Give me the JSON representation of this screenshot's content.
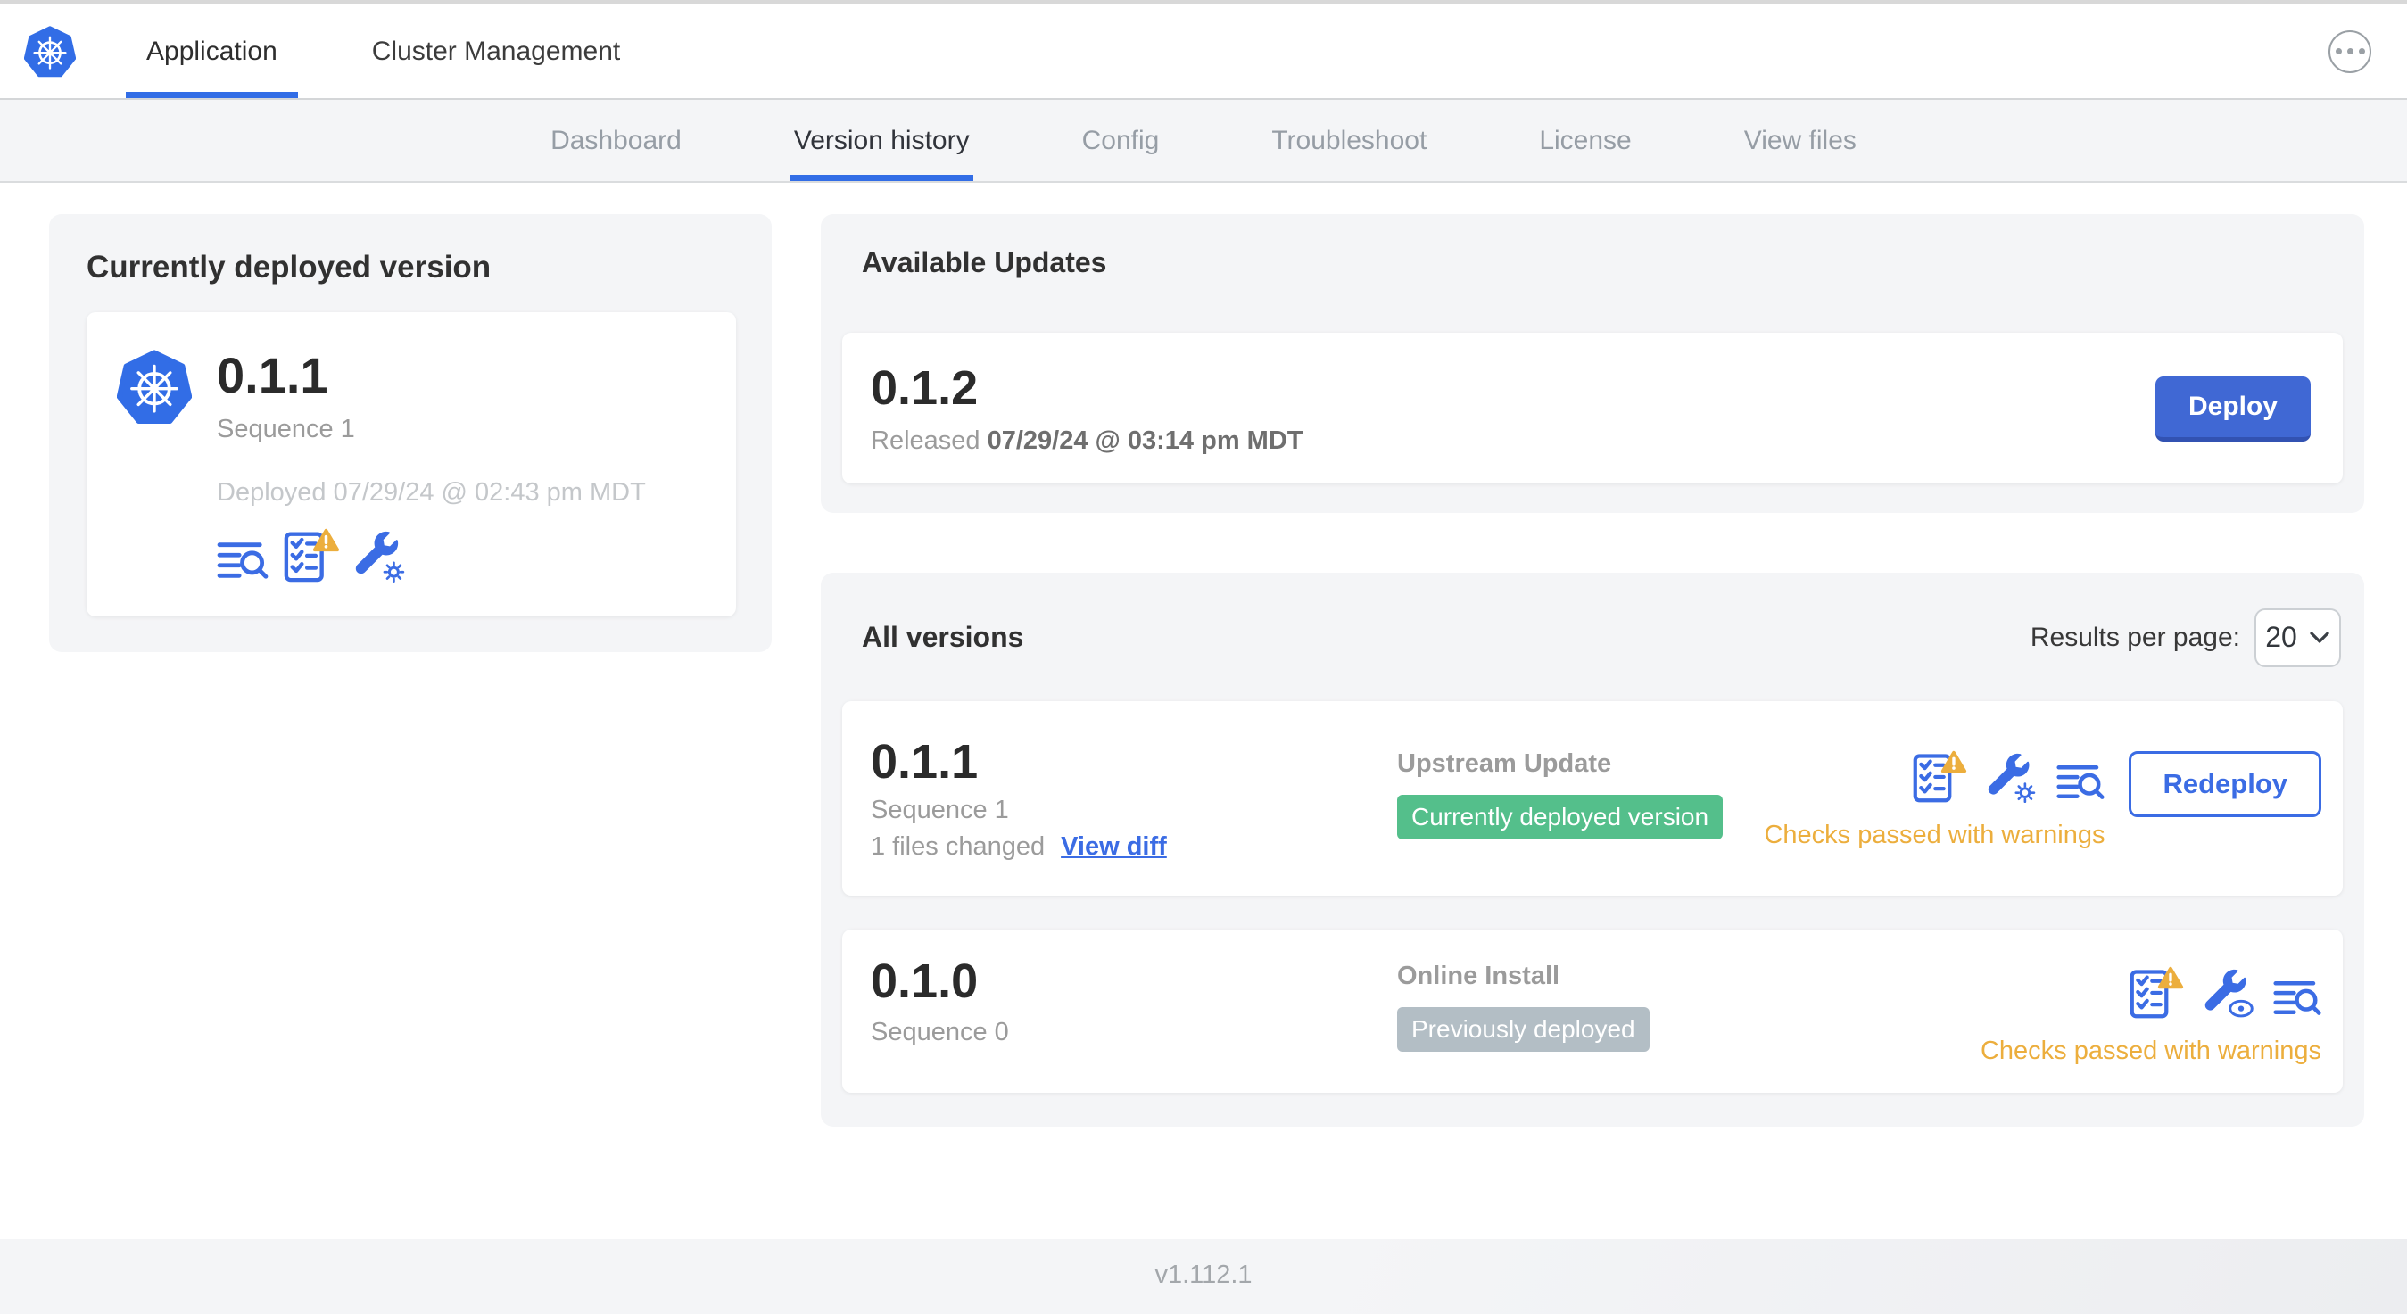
{
  "header": {
    "tabs": [
      {
        "label": "Application"
      },
      {
        "label": "Cluster Management"
      }
    ]
  },
  "subnav": {
    "tabs": [
      {
        "label": "Dashboard"
      },
      {
        "label": "Version history"
      },
      {
        "label": "Config"
      },
      {
        "label": "Troubleshoot"
      },
      {
        "label": "License"
      },
      {
        "label": "View files"
      }
    ]
  },
  "current_version_card": {
    "title": "Currently deployed version",
    "version": "0.1.1",
    "sequence": "Sequence 1",
    "deployed": "Deployed 07/29/24 @ 02:43 pm MDT"
  },
  "available_updates": {
    "title": "Available Updates",
    "update": {
      "version": "0.1.2",
      "released_label": "Released",
      "released_value": "07/29/24 @ 03:14 pm MDT",
      "deploy_label": "Deploy"
    }
  },
  "all_versions": {
    "title": "All versions",
    "results_per_page_label": "Results per page:",
    "results_per_page_value": "20",
    "rows": [
      {
        "version": "0.1.1",
        "sequence": "Sequence 1",
        "files_changed": "1 files changed",
        "view_diff_label": "View diff",
        "source": "Upstream Update",
        "badge": "Currently deployed version",
        "checks": "Checks passed with warnings",
        "action_label": "Redeploy"
      },
      {
        "version": "0.1.0",
        "sequence": "Sequence 0",
        "source": "Online Install",
        "badge": "Previously deployed",
        "checks": "Checks passed with warnings"
      }
    ]
  },
  "footer": {
    "console_version": "v1.112.1"
  },
  "colors": {
    "primary_blue": "#3b6ce4",
    "logo_blue": "#326de6",
    "success_green": "#54bf8b",
    "muted_badge_gray": "#b3bec5",
    "warning_orange": "#ecae3d"
  }
}
